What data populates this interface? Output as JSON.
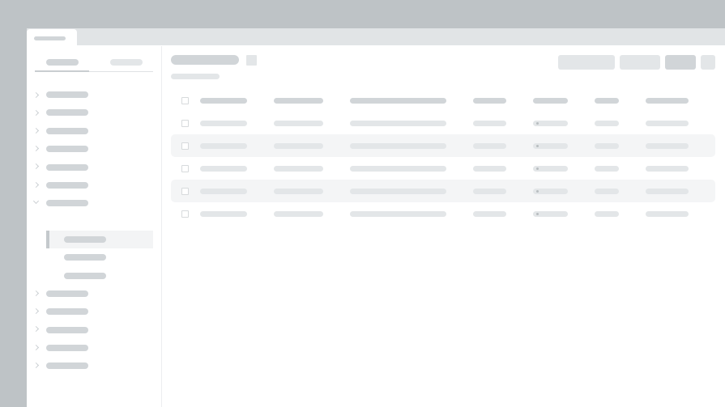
{
  "window": {
    "tab_label": ""
  },
  "sidebar": {
    "tabs": [
      {
        "label": ""
      },
      {
        "label": ""
      }
    ],
    "items": [
      {
        "label": ""
      },
      {
        "label": ""
      },
      {
        "label": ""
      },
      {
        "label": ""
      },
      {
        "label": ""
      },
      {
        "label": ""
      },
      {
        "label": ""
      },
      {
        "label": ""
      },
      {
        "label": ""
      },
      {
        "label": ""
      },
      {
        "label": ""
      },
      {
        "label": ""
      }
    ],
    "children": [
      {
        "label": ""
      },
      {
        "label": ""
      },
      {
        "label": ""
      }
    ]
  },
  "main": {
    "title": "",
    "subtitle": "",
    "buttons": [
      {
        "label": ""
      },
      {
        "label": ""
      },
      {
        "label": ""
      },
      {
        "label": ""
      }
    ]
  },
  "table": {
    "columns": [
      "",
      "",
      "",
      "",
      "",
      "",
      ""
    ],
    "rows": [
      [
        "",
        "",
        "",
        "",
        "",
        "",
        ""
      ],
      [
        "",
        "",
        "",
        "",
        "",
        "",
        ""
      ],
      [
        "",
        "",
        "",
        "",
        "",
        "",
        ""
      ],
      [
        "",
        "",
        "",
        "",
        "",
        "",
        ""
      ],
      [
        "",
        "",
        "",
        "",
        "",
        "",
        ""
      ]
    ]
  },
  "colors": {
    "window_background": "#bec3c6",
    "tabstrip": "#e1e4e6",
    "placeholder_dark": "#d1d5d8",
    "placeholder_light": "#e3e6e8",
    "striped_row": "#f4f5f6"
  }
}
